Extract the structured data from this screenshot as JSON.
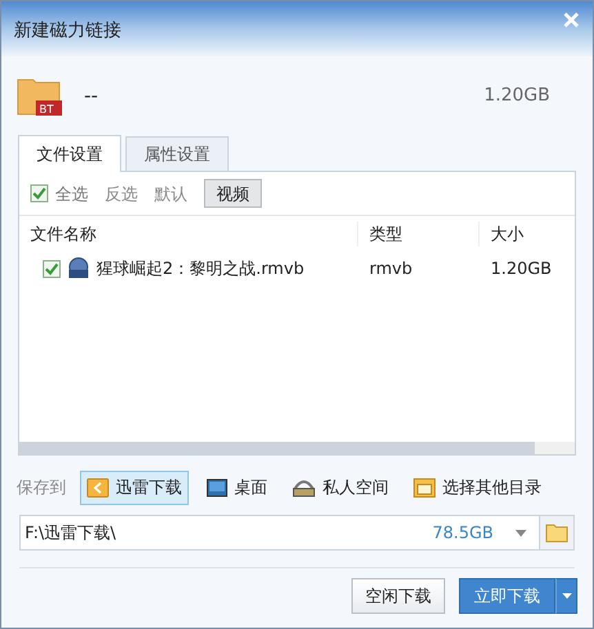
{
  "window": {
    "title": "新建磁力链接"
  },
  "torrent": {
    "badge": "BT",
    "name": "--",
    "size": "1.20GB"
  },
  "tabs": [
    {
      "label": "文件设置",
      "selected": true
    },
    {
      "label": "属性设置",
      "selected": false
    }
  ],
  "select_all": {
    "label": "全选",
    "checked": true
  },
  "filters": [
    {
      "label": "反选",
      "selected": false
    },
    {
      "label": "默认",
      "selected": false
    },
    {
      "label": "视频",
      "selected": true
    }
  ],
  "table": {
    "columns": [
      "文件名称",
      "类型",
      "大小"
    ],
    "rows": [
      {
        "checked": true,
        "name": "猩球崛起2：黎明之战.rmvb",
        "type": "rmvb",
        "size": "1.20GB"
      }
    ]
  },
  "save_to": {
    "label": "保存到",
    "options": [
      {
        "kind": "download",
        "label": "迅雷下载",
        "selected": true
      },
      {
        "kind": "desktop",
        "label": "桌面",
        "selected": false
      },
      {
        "kind": "private",
        "label": "私人空间",
        "selected": false
      },
      {
        "kind": "browse",
        "label": "选择其他目录",
        "selected": false
      }
    ]
  },
  "path": {
    "value": "F:\\迅雷下载\\",
    "free_space": "78.5GB"
  },
  "buttons": [
    {
      "kind": "secondary",
      "label": "空闲下载"
    },
    {
      "kind": "primary",
      "label": "立即下载"
    }
  ]
}
